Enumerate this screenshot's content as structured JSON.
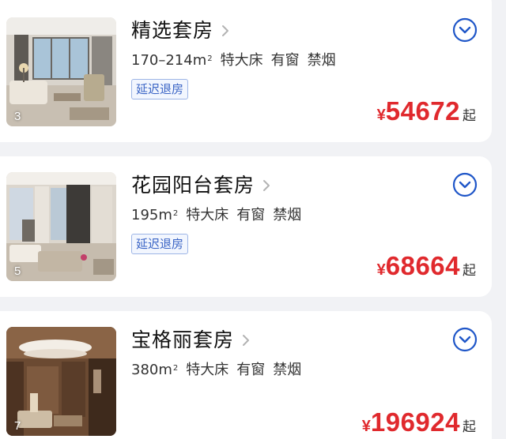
{
  "rooms": [
    {
      "name": "精选套房",
      "photo_count": "3",
      "area": "170–214m",
      "area_sup": "2",
      "bed": "特大床",
      "window": "有窗",
      "smoking": "禁烟",
      "tag": "延迟退房",
      "currency": "¥",
      "price": "54672",
      "price_suffix": "起"
    },
    {
      "name": "花园阳台套房",
      "photo_count": "5",
      "area": "195m",
      "area_sup": "2",
      "bed": "特大床",
      "window": "有窗",
      "smoking": "禁烟",
      "tag": "延迟退房",
      "currency": "¥",
      "price": "68664",
      "price_suffix": "起"
    },
    {
      "name": "宝格丽套房",
      "photo_count": "7",
      "area": "380m",
      "area_sup": "2",
      "bed": "特大床",
      "window": "有窗",
      "smoking": "禁烟",
      "currency": "¥",
      "price": "196924",
      "price_suffix": "起"
    }
  ],
  "icons": {
    "title_chevron": "chevron-right-icon",
    "expand": "chevron-down-circle-icon"
  },
  "colors": {
    "price": "#e0292d",
    "accent_blue": "#1f56c8",
    "tag_text": "#3a64c5"
  }
}
